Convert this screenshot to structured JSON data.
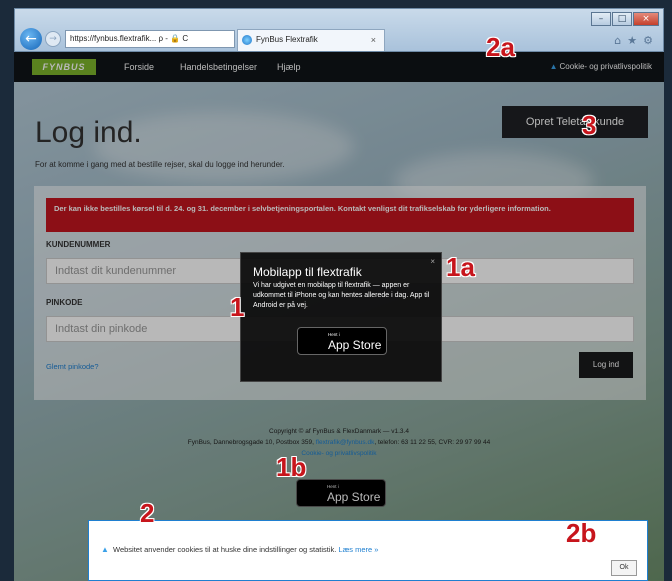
{
  "browser": {
    "address": "https://fynbus.flextrafik...",
    "address_domain": "flextrafik",
    "address_suffix": " ρ - 🔒 C",
    "tab_title": "FynBus Flextrafik",
    "tab_close": "×",
    "back": "←",
    "forward": "→",
    "win_min": "–",
    "win_max": "□",
    "win_close": "×",
    "tool_home": "⌂",
    "tool_star": "★",
    "tool_gear": "⚙"
  },
  "nav": {
    "logo": "FYNBUS",
    "items": [
      "Forside",
      "Handelsbetingelser",
      "Hjælp"
    ],
    "cookie_link": "Cookie- og privatlivspolitik"
  },
  "page": {
    "title": "Log ind.",
    "intro": "For at komme i gang med at bestille rejser, skal du logge ind herunder.",
    "teletax_button": "Opret Teletax kunde",
    "alert": "Der kan ikke bestilles kørsel til d. 24. og 31. december i selvbetjeningsportalen. Kontakt venligst dit trafikselskab for yderligere information.",
    "customer_label": "KUNDENUMMER",
    "customer_placeholder": "Indtast dit kundenummer",
    "pin_label": "PINKODE",
    "pin_placeholder": "Indtast din pinkode",
    "forgot": "Glemt pinkode?",
    "login_button": "Log ind"
  },
  "footer": {
    "copyright": "Copyright © af FynBus & FlexDanmark — v1.3.4",
    "address_pre": "FynBus, Dannebrogsgade 10, Postbox 359, ",
    "email": "flextrafik@fynbus.dk",
    "address_post": ", telefon: 63 11 22 55, CVR: 29 97 99 44",
    "policy_link": "Cookie- og privatlivspolitik"
  },
  "appstore": {
    "small": "Hent i",
    "big": "App Store"
  },
  "modal": {
    "title": "Mobilapp til flextrafik",
    "body": "Vi har udgivet en mobilapp til flextrafik — appen er udkommet til iPhone og kan hentes allerede i dag. App til Android er på vej.",
    "close": "×"
  },
  "cookie_bar": {
    "text": "Websitet anvender cookies til at huske dine indstillinger og statistik.",
    "more": "Læs mere »",
    "ok": "Ok"
  },
  "callouts": {
    "c1": "1",
    "c1a": "1a",
    "c1b": "1b",
    "c2": "2",
    "c2a": "2a",
    "c2b": "2b",
    "c3": "3"
  },
  "colors": {
    "accent_red": "#c3151f",
    "logo_green": "#7db52b",
    "link_blue": "#1e7fd0"
  }
}
